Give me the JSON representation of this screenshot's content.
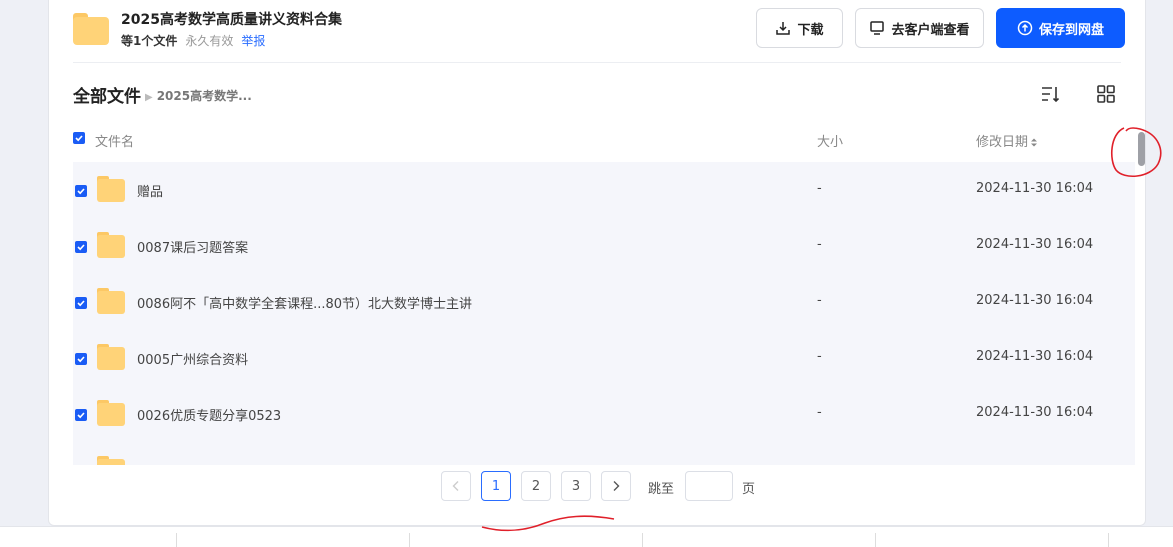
{
  "share": {
    "title": "2025高考数学高质量讲义资料合集",
    "file_count": "等1个文件",
    "validity": "永久有效",
    "report": "举报"
  },
  "actions": {
    "download": "下载",
    "open_client": "去客户端查看",
    "save_to_disk": "保存到网盘"
  },
  "breadcrumb": {
    "root": "全部文件",
    "current": "2025高考数学..."
  },
  "columns": {
    "name": "文件名",
    "size": "大小",
    "modified": "修改日期"
  },
  "files": [
    {
      "name": "赠品",
      "size": "-",
      "modified": "2024-11-30 16:04",
      "checked": true
    },
    {
      "name": "0087课后习题答案",
      "size": "-",
      "modified": "2024-11-30 16:04",
      "checked": true
    },
    {
      "name": "0086阿不「高中数学全套课程...80节）北大数学博士主讲",
      "size": "-",
      "modified": "2024-11-30 16:04",
      "checked": true
    },
    {
      "name": "0005广州综合资料",
      "size": "-",
      "modified": "2024-11-30 16:04",
      "checked": true
    },
    {
      "name": "0026优质专题分享0523",
      "size": "-",
      "modified": "2024-11-30 16:04",
      "checked": true
    }
  ],
  "pagination": {
    "pages": [
      "1",
      "2",
      "3"
    ],
    "current": "1",
    "jump_label": "跳至",
    "page_unit": "页"
  },
  "colors": {
    "accent": "#0d5cff",
    "folder": "#ffd378",
    "annotation": "#e0202a"
  }
}
